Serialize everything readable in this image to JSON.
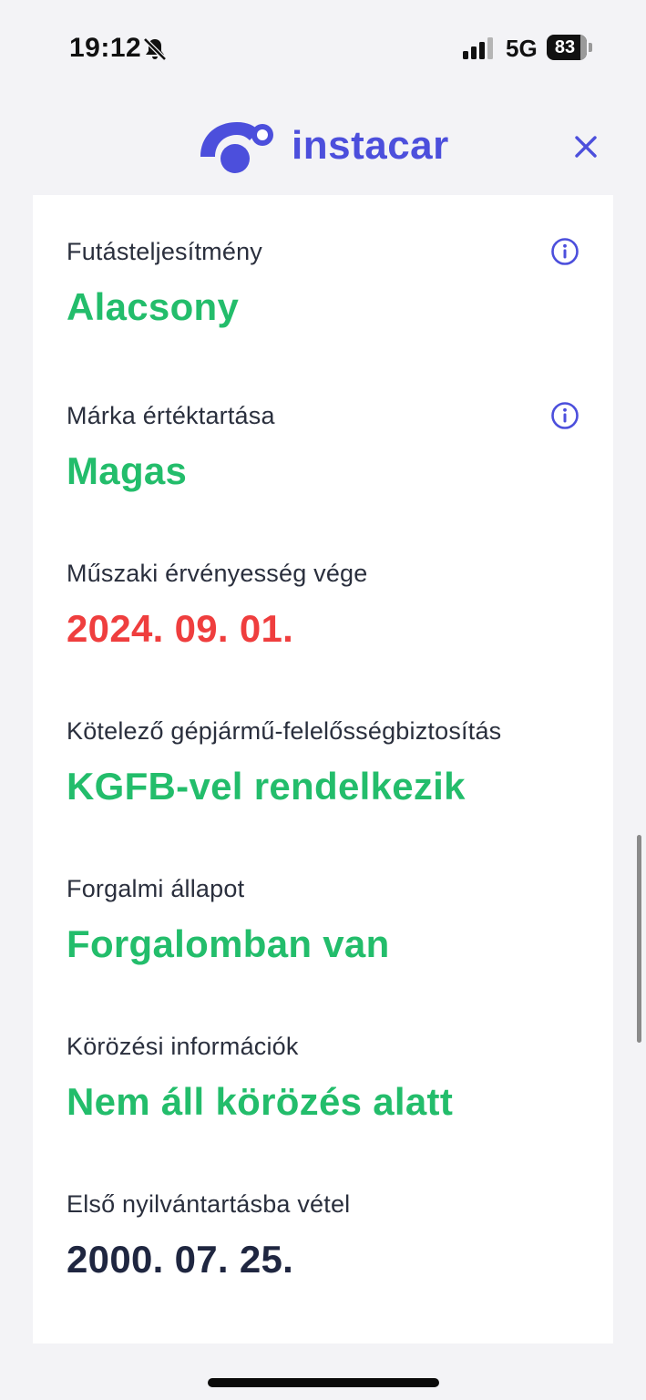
{
  "status_bar": {
    "time": "19:12",
    "network": "5G",
    "battery_level": "83",
    "icons": [
      "bell-slash-icon",
      "signal-icon",
      "battery-icon"
    ]
  },
  "header": {
    "logo_text": "instacar",
    "close_icon": "close-icon",
    "accent_color": "#4c4fdc"
  },
  "colors": {
    "positive": "#23bd6b",
    "warning": "#ef3e3e",
    "neutral": "#1f2640"
  },
  "fields": [
    {
      "label": "Futásteljesítmény",
      "value": "Alacsony",
      "status": "positive",
      "has_info": true
    },
    {
      "label": "Márka értéktartása",
      "value": "Magas",
      "status": "positive",
      "has_info": true
    },
    {
      "label": "Műszaki érvényesség vége",
      "value": "2024. 09. 01.",
      "status": "warning",
      "has_info": false
    },
    {
      "label": "Kötelező gépjármű-felelősségbiztosítás",
      "value": "KGFB-vel rendelkezik",
      "status": "positive",
      "has_info": false
    },
    {
      "label": "Forgalmi állapot",
      "value": "Forgalomban van",
      "status": "positive",
      "has_info": false
    },
    {
      "label": "Körözési információk",
      "value": "Nem áll körözés alatt",
      "status": "positive",
      "has_info": false
    },
    {
      "label": "Első nyilvántartásba vétel",
      "value": "2000. 07. 25.",
      "status": "neutral",
      "has_info": false
    }
  ]
}
